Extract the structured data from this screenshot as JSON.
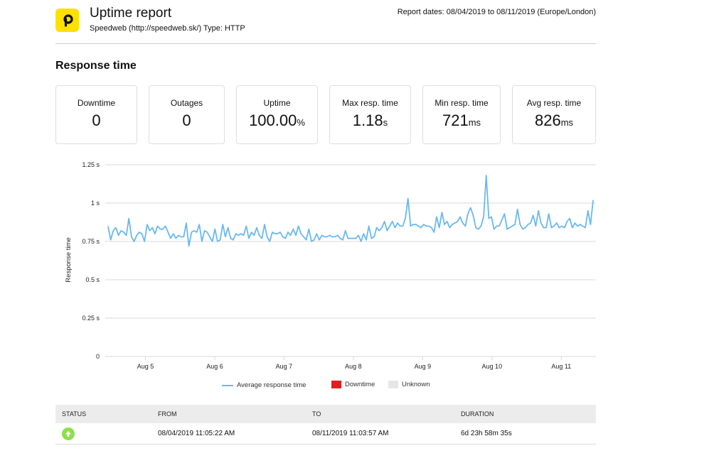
{
  "header": {
    "logo_letter": "p",
    "title": "Uptime report",
    "subtitle": "Speedweb (http://speedweb.sk/) Type: HTTP",
    "report_dates": "Report dates: 08/04/2019 to 08/11/2019 (Europe/London)"
  },
  "section_title": "Response time",
  "stats": [
    {
      "label": "Downtime",
      "value": "0",
      "unit": ""
    },
    {
      "label": "Outages",
      "value": "0",
      "unit": ""
    },
    {
      "label": "Uptime",
      "value": "100.00",
      "unit": "%"
    },
    {
      "label": "Max resp. time",
      "value": "1.18",
      "unit": "s"
    },
    {
      "label": "Min resp. time",
      "value": "721",
      "unit": "ms"
    },
    {
      "label": "Avg resp. time",
      "value": "826",
      "unit": "ms"
    }
  ],
  "colors": {
    "line": "#6ab8f0",
    "downtime": "#e02020",
    "unknown": "#e6e6e6",
    "status_up": "#8ee04a",
    "logo": "#ffe100"
  },
  "chart_data": {
    "type": "line",
    "title": "",
    "xlabel": "",
    "ylabel": "Response time",
    "ylim": [
      0,
      1.25
    ],
    "yticks": [
      0,
      0.25,
      0.5,
      0.75,
      1,
      1.25
    ],
    "ytick_labels": [
      "0",
      "0.25 s",
      "0.5 s",
      "0.75 s",
      "1 s",
      "1.25 s"
    ],
    "xlim": [
      4.42,
      11.5
    ],
    "xticks": [
      5,
      6,
      7,
      8,
      9,
      10,
      11
    ],
    "xtick_labels": [
      "Aug 5",
      "Aug 6",
      "Aug 7",
      "Aug 8",
      "Aug 9",
      "Aug 10",
      "Aug 11"
    ],
    "grid": true,
    "legend": {
      "placement": "bottom-center",
      "entries": [
        "Average response time",
        "Downtime",
        "Unknown"
      ]
    },
    "x_start": 4.46,
    "x_step": 0.0422,
    "series": [
      {
        "name": "Average response time",
        "values": [
          0.85,
          0.76,
          0.82,
          0.84,
          0.79,
          0.82,
          0.81,
          0.79,
          0.9,
          0.78,
          0.75,
          0.79,
          0.81,
          0.8,
          0.75,
          0.86,
          0.82,
          0.84,
          0.8,
          0.85,
          0.83,
          0.83,
          0.85,
          0.81,
          0.77,
          0.8,
          0.77,
          0.79,
          0.78,
          0.78,
          0.87,
          0.72,
          0.81,
          0.82,
          0.81,
          0.86,
          0.75,
          0.82,
          0.81,
          0.78,
          0.75,
          0.83,
          0.75,
          0.76,
          0.86,
          0.78,
          0.84,
          0.77,
          0.76,
          0.8,
          0.79,
          0.8,
          0.79,
          0.85,
          0.77,
          0.81,
          0.79,
          0.84,
          0.79,
          0.77,
          0.86,
          0.78,
          0.75,
          0.81,
          0.8,
          0.8,
          0.81,
          0.78,
          0.77,
          0.81,
          0.79,
          0.83,
          0.79,
          0.85,
          0.8,
          0.78,
          0.76,
          0.83,
          0.75,
          0.76,
          0.8,
          0.76,
          0.79,
          0.78,
          0.78,
          0.79,
          0.78,
          0.78,
          0.79,
          0.77,
          0.76,
          0.82,
          0.77,
          0.77,
          0.77,
          0.77,
          0.79,
          0.75,
          0.8,
          0.76,
          0.85,
          0.77,
          0.78,
          0.84,
          0.82,
          0.84,
          0.88,
          0.82,
          0.85,
          0.88,
          0.84,
          0.87,
          0.85,
          0.85,
          0.9,
          1.03,
          0.85,
          0.86,
          0.86,
          0.85,
          0.84,
          0.86,
          0.85,
          0.85,
          0.84,
          0.81,
          0.91,
          0.84,
          0.94,
          0.86,
          0.88,
          0.84,
          0.86,
          0.87,
          0.88,
          0.91,
          0.87,
          0.85,
          0.93,
          0.97,
          0.92,
          0.84,
          0.83,
          0.85,
          0.91,
          1.18,
          0.9,
          0.91,
          0.83,
          0.85,
          0.85,
          0.89,
          0.93,
          0.83,
          0.84,
          0.85,
          0.86,
          0.96,
          0.86,
          0.83,
          0.84,
          0.86,
          0.87,
          0.92,
          0.85,
          0.95,
          0.87,
          0.84,
          0.84,
          0.93,
          0.84,
          0.85,
          0.87,
          0.84,
          0.85,
          0.84,
          0.88,
          0.9,
          0.84,
          0.87,
          0.85,
          0.86,
          0.85,
          0.84,
          0.95,
          0.86,
          1.02
        ]
      }
    ]
  },
  "table": {
    "columns": [
      "STATUS",
      "FROM",
      "TO",
      "DURATION"
    ],
    "rows": [
      {
        "status": "up",
        "status_icon": "arrow-up-icon",
        "from": "08/04/2019 11:05:22 AM",
        "to": "08/11/2019 11:03:57 AM",
        "duration": "6d 23h 58m 35s"
      }
    ]
  }
}
